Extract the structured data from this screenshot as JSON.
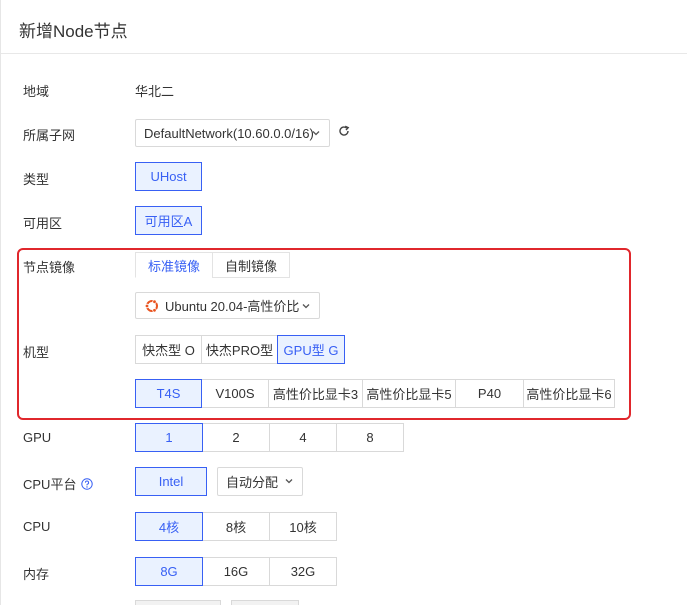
{
  "dialog": {
    "title": "新增Node节点"
  },
  "region": {
    "label": "地域",
    "value": "华北二"
  },
  "subnet": {
    "label": "所属子网",
    "value": "DefaultNetwork(10.60.0.0/16)"
  },
  "type": {
    "label": "类型",
    "options": [
      "UHost"
    ],
    "selected": 0
  },
  "zone": {
    "label": "可用区",
    "options": [
      "可用区A"
    ],
    "selected": 0
  },
  "image": {
    "label": "节点镜像",
    "tabs": [
      "标准镜像",
      "自制镜像"
    ],
    "active_tab": 0,
    "os_value": "Ubuntu 20.04-高性价比"
  },
  "machine": {
    "label": "机型",
    "families": [
      "快杰型 O",
      "快杰PRO型",
      "GPU型 G"
    ],
    "selected_family": 2,
    "gpu_models": [
      "T4S",
      "V100S",
      "高性价比显卡3",
      "高性价比显卡5",
      "P40",
      "高性价比显卡6"
    ],
    "selected_model": 0
  },
  "gpu": {
    "label": "GPU",
    "options": [
      "1",
      "2",
      "4",
      "8"
    ],
    "selected": 0
  },
  "cpu_platform": {
    "label": "CPU平台",
    "options": [
      "Intel"
    ],
    "selected": 0,
    "auto_value": "自动分配"
  },
  "cpu": {
    "label": "CPU",
    "options": [
      "4核",
      "8核",
      "10核"
    ],
    "selected": 0
  },
  "memory": {
    "label": "内存",
    "options": [
      "8G",
      "16G",
      "32G"
    ],
    "selected": 0
  },
  "colors": {
    "accent": "#3860f4",
    "highlight": "#e0272c",
    "ubuntu": "#e95420"
  }
}
